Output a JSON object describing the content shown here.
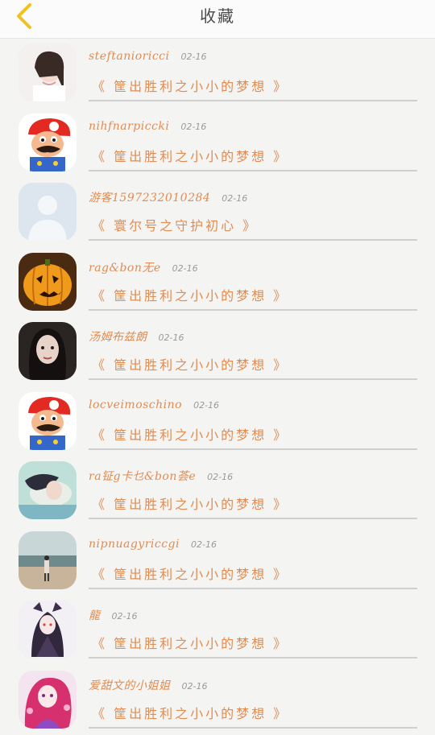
{
  "header": {
    "title": "收藏",
    "back_icon": "chevron-left-icon",
    "accent": "#f0c21c"
  },
  "items": [
    {
      "name": "steftanioricci",
      "date": "02-16",
      "book": "《 筐出胜利之小小的梦想 》",
      "avatar": "girl-photo"
    },
    {
      "name": "nihfnarpiccki",
      "date": "02-16",
      "book": "《 筐出胜利之小小的梦想 》",
      "avatar": "mario"
    },
    {
      "name": "游客1597232010284",
      "date": "02-16",
      "book": "《 寰尔号之守护初心 》",
      "avatar": "default-user"
    },
    {
      "name": "rag&bon无e",
      "date": "02-16",
      "book": "《 筐出胜利之小小的梦想 》",
      "avatar": "pumpkin"
    },
    {
      "name": "汤姆布兹朗",
      "date": "02-16",
      "book": "《 筐出胜利之小小的梦想 》",
      "avatar": "girl-dark"
    },
    {
      "name": "locveimoschino",
      "date": "02-16",
      "book": "《 筐出胜利之小小的梦想 》",
      "avatar": "mario"
    },
    {
      "name": "ra钲g卡乜&bon荟e",
      "date": "02-16",
      "book": "《 筐出胜利之小小的梦想 》",
      "avatar": "girl-lying"
    },
    {
      "name": "nipnuagyriccgi",
      "date": "02-16",
      "book": "《 筐出胜利之小小的梦想 》",
      "avatar": "beach"
    },
    {
      "name": "龍",
      "date": "02-16",
      "book": "《 筐出胜利之小小的梦想 》",
      "avatar": "anime-dark"
    },
    {
      "name": "爱甜文的小姐姐",
      "date": "02-16",
      "book": "《 筐出胜利之小小的梦想 》",
      "avatar": "anime-pink"
    }
  ]
}
